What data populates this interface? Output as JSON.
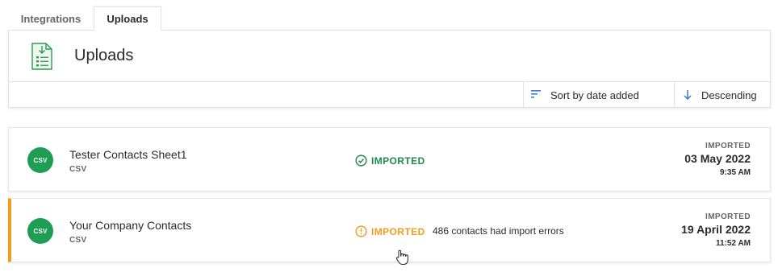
{
  "tabs": [
    {
      "label": "Integrations",
      "active": false
    },
    {
      "label": "Uploads",
      "active": true
    }
  ],
  "panel": {
    "title": "Uploads",
    "icon": "upload-document-icon",
    "sort_label": "Sort by date added",
    "order_label": "Descending"
  },
  "uploads": [
    {
      "name": "Tester Contacts Sheet1",
      "type": "CSV",
      "badge": "CSV",
      "status": "IMPORTED",
      "status_kind": "success",
      "note": "",
      "date_label": "IMPORTED",
      "date": "03 May 2022",
      "time": "9:35 AM"
    },
    {
      "name": "Your Company Contacts",
      "type": "CSV",
      "badge": "CSV",
      "status": "IMPORTED",
      "status_kind": "warning",
      "note": "486 contacts had import errors",
      "date_label": "IMPORTED",
      "date": "19 April 2022",
      "time": "11:52 AM"
    }
  ],
  "colors": {
    "success": "#1f8a4c",
    "warning": "#f39c1f",
    "badge": "#1f9d55",
    "accent": "#3a7bd5"
  }
}
